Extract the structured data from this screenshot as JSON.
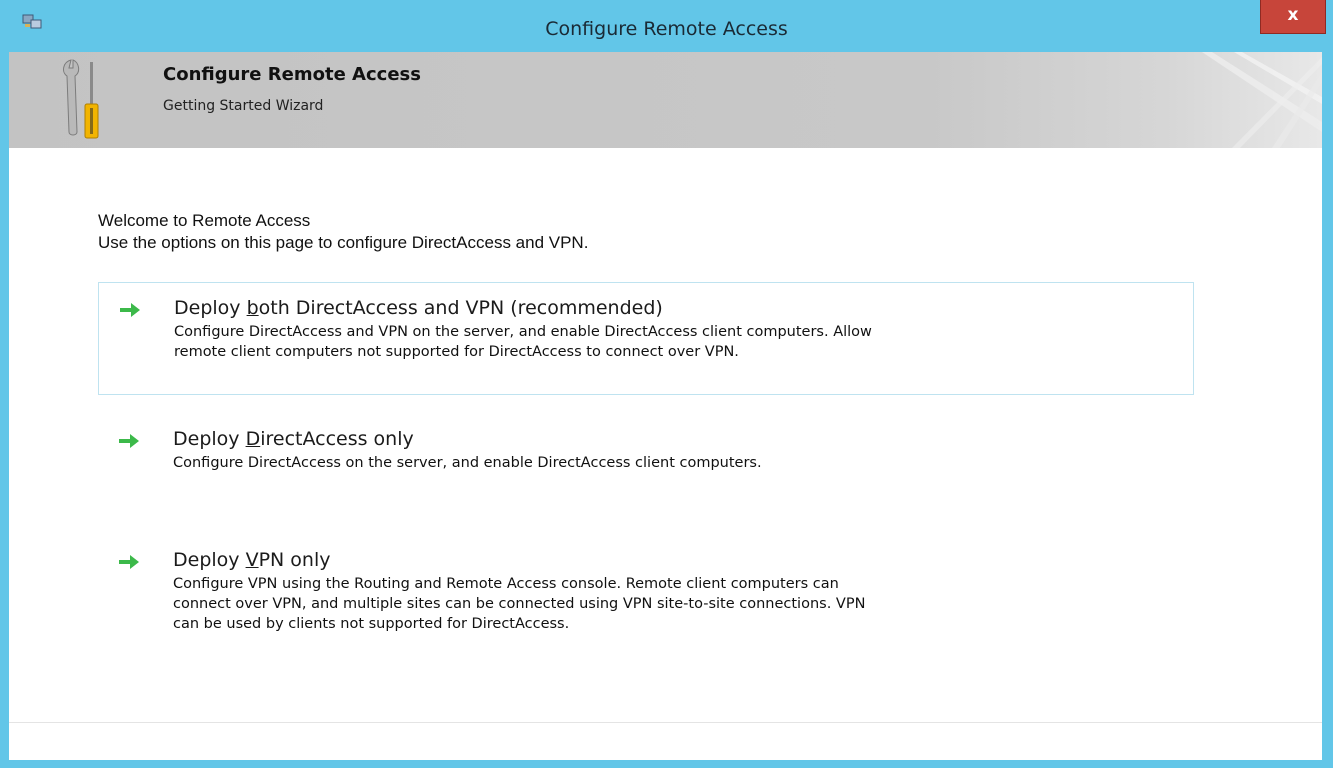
{
  "window": {
    "title": "Configure Remote Access",
    "close_label": "x"
  },
  "banner": {
    "title": "Configure Remote Access",
    "subtitle": "Getting Started Wizard"
  },
  "welcome": {
    "line1": "Welcome to Remote Access",
    "line2": "Use the options on this page to configure DirectAccess and VPN."
  },
  "options": [
    {
      "title_pre": "Deploy ",
      "title_key": "b",
      "title_post": "oth DirectAccess and VPN (recommended)",
      "desc_lines": [
        "Configure DirectAccess and VPN on the server, and enable DirectAccess client computers. Allow",
        "remote client computers not supported for DirectAccess to connect over VPN."
      ]
    },
    {
      "title_pre": "Deploy ",
      "title_key": "D",
      "title_post": "irectAccess only",
      "desc_lines": [
        "Configure DirectAccess on the server, and enable DirectAccess client computers."
      ]
    },
    {
      "title_pre": "Deploy ",
      "title_key": "V",
      "title_post": "PN only",
      "desc_lines": [
        "Configure VPN using the Routing and Remote Access console. Remote client computers can",
        "connect over VPN, and multiple sites can be connected using VPN site-to-site connections. VPN",
        "can be used by clients not supported for DirectAccess."
      ]
    }
  ],
  "colors": {
    "titlebar": "#62c6e8",
    "close": "#c7453a",
    "arrow": "#3cb94a",
    "selected_border": "#bfe3f0"
  },
  "icons": {
    "app": "remote-access-app-icon",
    "banner": "wrench-screwdriver-icon",
    "option": "green-arrow-icon"
  }
}
